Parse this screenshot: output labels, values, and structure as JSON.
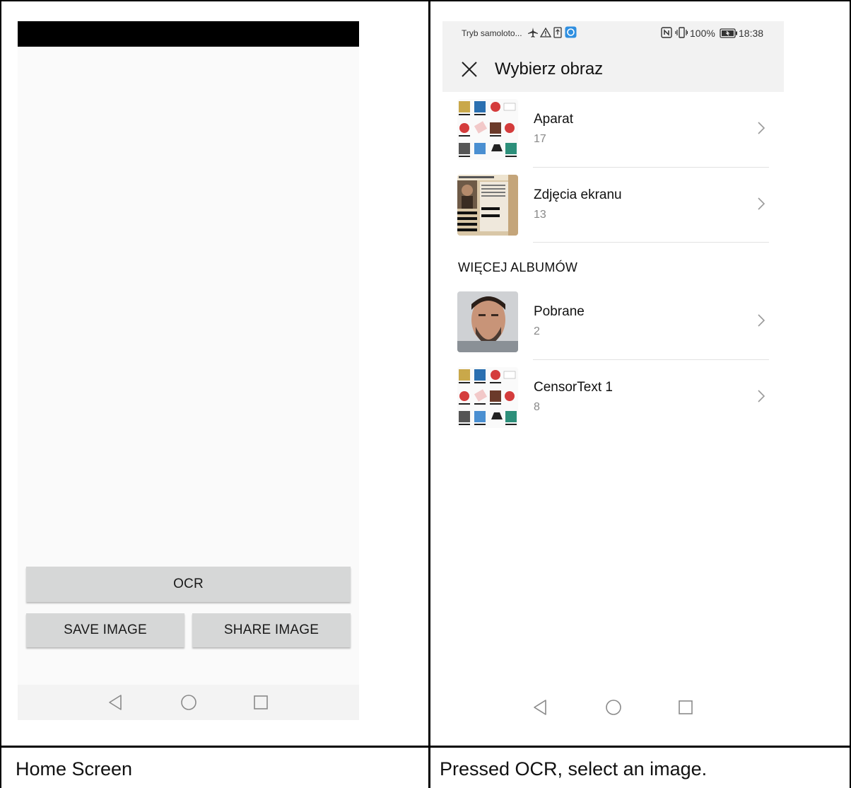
{
  "left_panel": {
    "buttons": {
      "ocr": "OCR",
      "save_image": "SAVE IMAGE",
      "share_image": "SHARE IMAGE"
    },
    "caption": "Home Screen"
  },
  "right_panel": {
    "status_bar": {
      "mode_text": "Tryb samoloto...",
      "battery": "100%",
      "time": "18:38"
    },
    "header": {
      "title": "Wybierz obraz"
    },
    "albums": [
      {
        "name": "Aparat",
        "count": "17"
      },
      {
        "name": "Zdjęcia ekranu",
        "count": "13"
      }
    ],
    "more_albums_heading": "WIĘCEJ ALBUMÓW",
    "more_albums": [
      {
        "name": "Pobrane",
        "count": "2"
      },
      {
        "name": "CensorText 1",
        "count": "8"
      }
    ],
    "caption": "Pressed OCR, select an image."
  },
  "colors": {
    "button_bg": "#d6d7d7",
    "header_bg": "#f2f2f2",
    "divider": "#e2e2e2",
    "count_text": "#888888"
  },
  "icons": {
    "nav": [
      "back-triangle-icon",
      "home-circle-icon",
      "recents-square-icon"
    ],
    "status": [
      "airplane-icon",
      "warning-icon",
      "sim-icon",
      "app-notification-icon",
      "nfc-icon",
      "vibrate-icon",
      "battery-icon"
    ],
    "header": "close-icon",
    "album_row": "chevron-right-icon"
  }
}
